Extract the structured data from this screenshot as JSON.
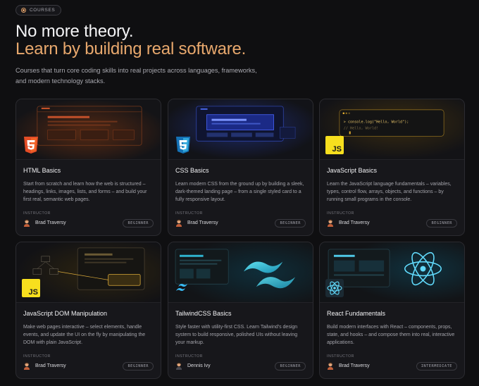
{
  "header": {
    "badge": "COURSES",
    "title_line1": "No more theory.",
    "title_line2": "Learn by building real software.",
    "subtitle": "Courses that turn core coding skills into real projects across languages, frameworks, and modern technology stacks."
  },
  "instructor_label": "INSTRUCTOR",
  "colors": {
    "accent": "#e8a86d",
    "background": "#0f0f11",
    "card": "#17171b"
  },
  "courses": [
    {
      "title": "HTML Basics",
      "description": "Start from scratch and learn how the web is structured – headings, links, images, lists, and forms – and build your first real, semantic web pages.",
      "instructor": "Brad Traversy",
      "level": "BEGINNER",
      "icon": "html5-icon"
    },
    {
      "title": "CSS Basics",
      "description": "Learn modern CSS from the ground up by building a sleek, dark-themed landing page – from a single styled card to a fully responsive layout.",
      "instructor": "Brad Traversy",
      "level": "BEGINNER",
      "icon": "css3-icon"
    },
    {
      "title": "JavaScript Basics",
      "description": "Learn the JavaScript language fundamentals – variables, types, control flow, arrays, objects, and functions – by running small programs in the console.",
      "instructor": "Brad Traversy",
      "level": "BEGINNER",
      "icon": "js-icon",
      "code_line1": "> console.log(\"Hello, World\");",
      "code_line2": "// Hello, World!"
    },
    {
      "title": "JavaScript DOM Manipulation",
      "description": "Make web pages interactive – select elements, handle events, and update the UI on the fly by manipulating the DOM with plain JavaScript.",
      "instructor": "Brad Traversy",
      "level": "BEGINNER",
      "icon": "js-icon"
    },
    {
      "title": "TailwindCSS Basics",
      "description": "Style faster with utility-first CSS. Learn Tailwind's design system to build responsive, polished UIs without leaving your markup.",
      "instructor": "Dennis Ivy",
      "level": "BEGINNER",
      "icon": "tailwind-icon"
    },
    {
      "title": "React Fundamentals",
      "description": "Build modern interfaces with React – components, props, state, and hooks – and compose them into real, interactive applications.",
      "instructor": "Brad Traversy",
      "level": "INTERMEDIATE",
      "icon": "react-icon"
    }
  ]
}
